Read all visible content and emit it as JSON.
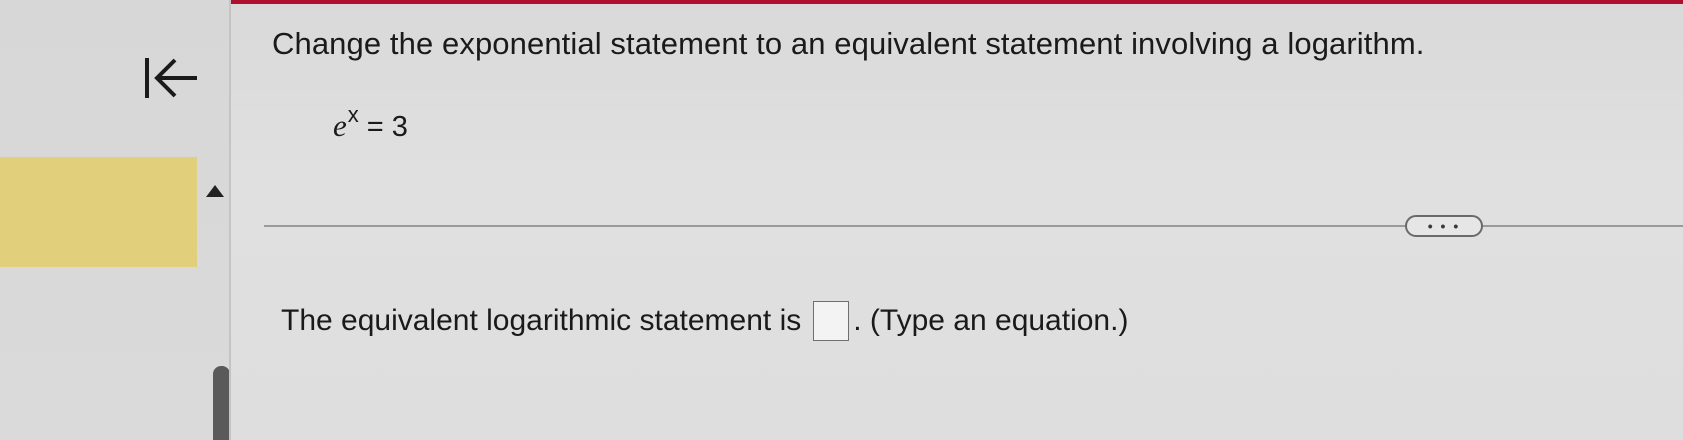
{
  "sidebar": {
    "back_icon": "first-page-arrow-icon",
    "collapse_icon": "triangle-up-icon"
  },
  "question": {
    "title": "Change the exponential statement to an equivalent statement involving a logarithm.",
    "equation": {
      "base": "e",
      "exponent": "x",
      "rest": "= 3"
    }
  },
  "more_button": {
    "label": "• • •"
  },
  "answer": {
    "prefix": "The equivalent logarithmic statement is",
    "value": "",
    "suffix": ". (Type an equation.)"
  },
  "colors": {
    "accent": "#b01030",
    "highlight": "#e2cf7c"
  }
}
